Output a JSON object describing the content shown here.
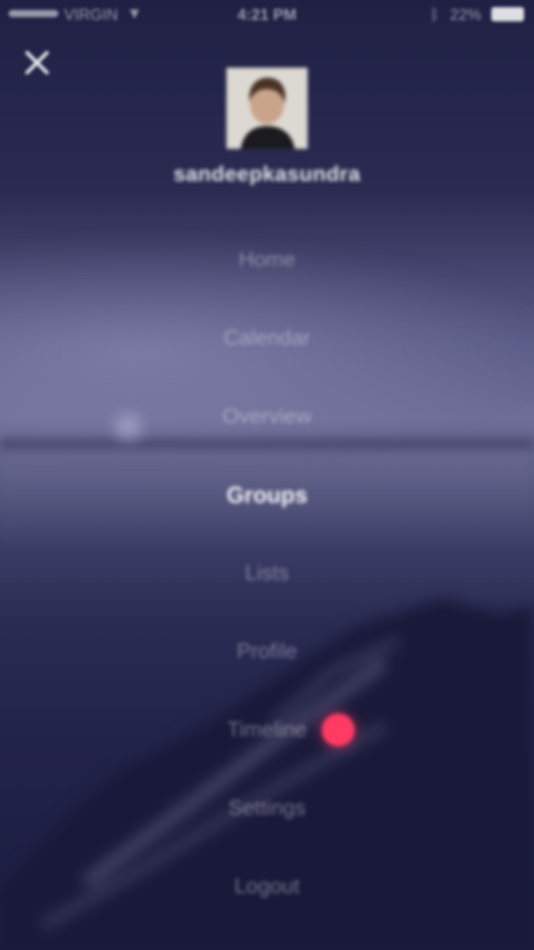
{
  "status_bar": {
    "carrier": "VIRGIN",
    "time": "4:21 PM",
    "battery": "22%"
  },
  "profile": {
    "username": "sandeepkasundra"
  },
  "menu": {
    "items": [
      {
        "label": "Home"
      },
      {
        "label": "Calendar"
      },
      {
        "label": "Overview"
      },
      {
        "label": "Groups"
      },
      {
        "label": "Lists"
      },
      {
        "label": "Profile"
      },
      {
        "label": "Timeline"
      },
      {
        "label": "Settings"
      },
      {
        "label": "Logout"
      }
    ],
    "active_item": "Groups"
  },
  "colors": {
    "accent": "#ff3b64",
    "background": "#26264a"
  },
  "icons": {
    "close": "close-icon",
    "wifi": "wifi-icon",
    "bluetooth": "bluetooth-icon",
    "battery": "battery-icon"
  }
}
